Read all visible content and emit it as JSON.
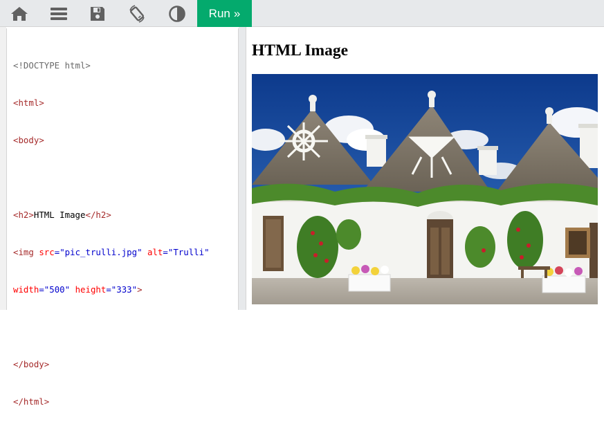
{
  "toolbar": {
    "icons": [
      "home-icon",
      "menu-icon",
      "save-icon",
      "rotate-icon",
      "theme-contrast-icon"
    ],
    "run_label": "Run",
    "run_chevron": "»"
  },
  "colors": {
    "toolbar_bg": "#e7e9eb",
    "run_bg": "#04aa6d",
    "tag": "#a52a2a",
    "attribute": "#ff0000",
    "value": "#0000cd"
  },
  "code": {
    "line1": "<!DOCTYPE html>",
    "line2_tag": "html",
    "line3_tag": "body",
    "line5_open": "h2",
    "line5_text": "HTML Image",
    "line5_close": "/h2",
    "line6_tag": "img",
    "line6_attr1": "src",
    "line6_val1": "\"pic_trulli.jpg\"",
    "line6_attr2": "alt",
    "line6_val2": "\"Trulli\"",
    "line7_attr1": "width",
    "line7_val1": "\"500\"",
    "line7_attr2": "height",
    "line7_val2": "\"333\"",
    "line9_tag": "/body",
    "line10_tag": "/html"
  },
  "result": {
    "heading": "HTML Image",
    "image_alt": "Trulli"
  }
}
